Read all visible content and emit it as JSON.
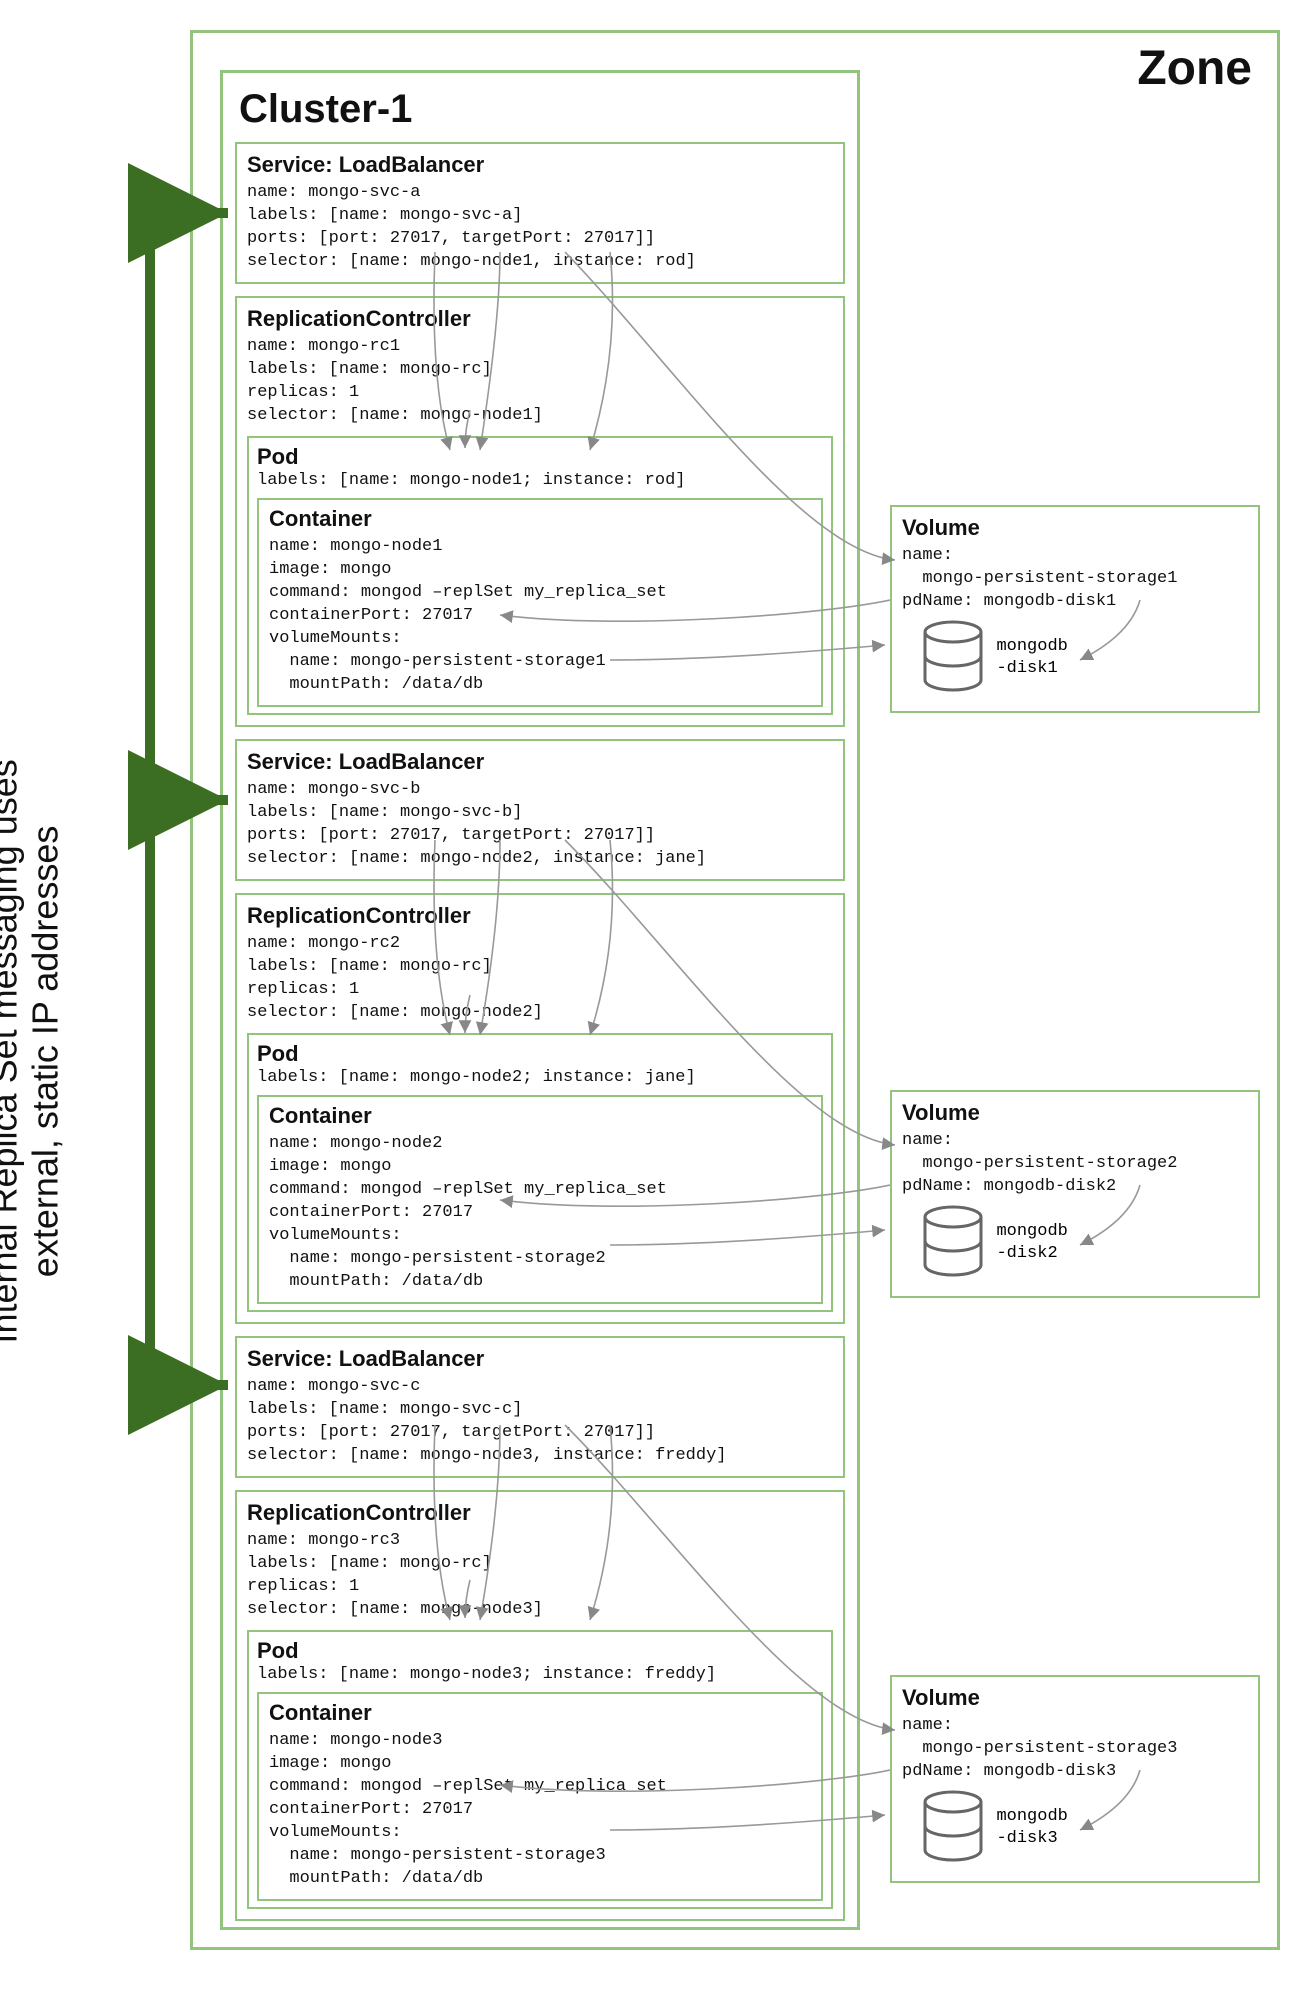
{
  "zone": {
    "title": "Zone"
  },
  "cluster": {
    "title": "Cluster-1"
  },
  "side_annotation": "Internal Replica Set messaging uses\nexternal, static IP addresses",
  "groups": [
    {
      "service": {
        "title": "Service: LoadBalancer",
        "body": "name: mongo-svc-a\nlabels: [name: mongo-svc-a]\nports: [port: 27017, targetPort: 27017]]\nselector: [name: mongo-node1, instance: rod]"
      },
      "rc": {
        "title": "ReplicationController",
        "body": "name: mongo-rc1\nlabels: [name: mongo-rc]\nreplicas: 1\nselector: [name: mongo-node1]",
        "pod": {
          "title": "Pod",
          "labels": "labels: [name: mongo-node1; instance: rod]",
          "container": {
            "title": "Container",
            "body": "name: mongo-node1\nimage: mongo\ncommand: mongod –replSet my_replica_set\ncontainerPort: 27017\nvolumeMounts:\n  name: mongo-persistent-storage1\n  mountPath: /data/db"
          }
        }
      },
      "volume": {
        "title": "Volume",
        "body": "name:\n  mongo-persistent-storage1\npdName: mongodb-disk1",
        "disk_label": "mongodb\n-disk1"
      }
    },
    {
      "service": {
        "title": "Service: LoadBalancer",
        "body": "name: mongo-svc-b\nlabels: [name: mongo-svc-b]\nports: [port: 27017, targetPort: 27017]]\nselector: [name: mongo-node2, instance: jane]"
      },
      "rc": {
        "title": "ReplicationController",
        "body": "name: mongo-rc2\nlabels: [name: mongo-rc]\nreplicas: 1\nselector: [name: mongo-node2]",
        "pod": {
          "title": "Pod",
          "labels": "labels: [name: mongo-node2; instance: jane]",
          "container": {
            "title": "Container",
            "body": "name: mongo-node2\nimage: mongo\ncommand: mongod –replSet my_replica_set\ncontainerPort: 27017\nvolumeMounts:\n  name: mongo-persistent-storage2\n  mountPath: /data/db"
          }
        }
      },
      "volume": {
        "title": "Volume",
        "body": "name:\n  mongo-persistent-storage2\npdName: mongodb-disk2",
        "disk_label": "mongodb\n-disk2"
      }
    },
    {
      "service": {
        "title": "Service: LoadBalancer",
        "body": "name: mongo-svc-c\nlabels: [name: mongo-svc-c]\nports: [port: 27017, targetPort: 27017]]\nselector: [name: mongo-node3, instance: freddy]"
      },
      "rc": {
        "title": "ReplicationController",
        "body": "name: mongo-rc3\nlabels: [name: mongo-rc]\nreplicas: 1\nselector: [name: mongo-node3]",
        "pod": {
          "title": "Pod",
          "labels": "labels: [name: mongo-node3; instance: freddy]",
          "container": {
            "title": "Container",
            "body": "name: mongo-node3\nimage: mongo\ncommand: mongod –replSet my_replica_set\ncontainerPort: 27017\nvolumeMounts:\n  name: mongo-persistent-storage3\n  mountPath: /data/db"
          }
        }
      },
      "volume": {
        "title": "Volume",
        "body": "name:\n  mongo-persistent-storage3\npdName: mongodb-disk3",
        "disk_label": "mongodb\n-disk3"
      }
    }
  ]
}
